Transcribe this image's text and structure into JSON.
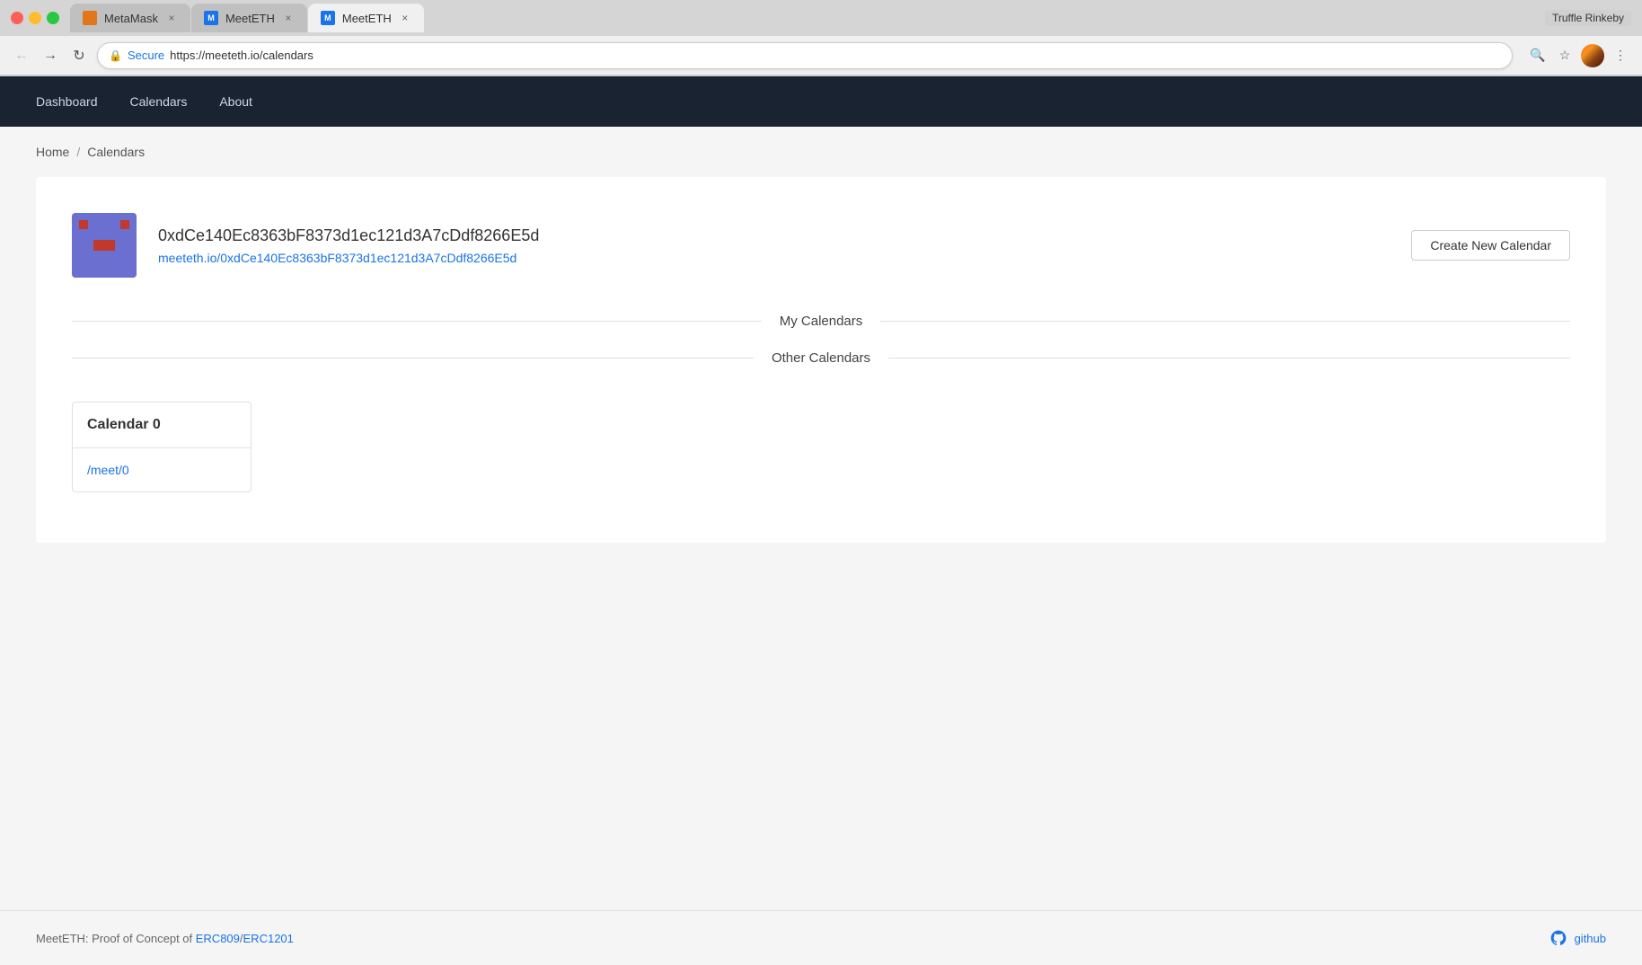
{
  "browser": {
    "tabs": [
      {
        "id": "metamask",
        "label": "MetaMask",
        "type": "metamask",
        "active": false
      },
      {
        "id": "meeteth1",
        "label": "MeetETH",
        "type": "meeteth",
        "active": false
      },
      {
        "id": "meeteth2",
        "label": "MeetETH",
        "type": "meeteth",
        "active": true
      }
    ],
    "right_label": "Truffle Rinkeby",
    "url": "https://meeteth.io/calendars",
    "secure_label": "Secure"
  },
  "nav": {
    "links": [
      {
        "id": "dashboard",
        "label": "Dashboard"
      },
      {
        "id": "calendars",
        "label": "Calendars"
      },
      {
        "id": "about",
        "label": "About"
      }
    ]
  },
  "breadcrumb": {
    "home": "Home",
    "separator": "/",
    "current": "Calendars"
  },
  "user": {
    "address": "0xdCe140Ec8363bF8373d1ec121d3A7cDdf8266E5d",
    "profile_url": "meeteth.io/0xdCe140Ec8363bF8373d1ec121d3A7cDdf8266E5d",
    "create_button": "Create New Calendar"
  },
  "sections": {
    "my_calendars": "My Calendars",
    "other_calendars": "Other Calendars"
  },
  "calendars": [
    {
      "name": "Calendar 0",
      "url": "/meet/0"
    }
  ],
  "footer": {
    "text_prefix": "MeetETH: Proof of Concept of ",
    "erc809": "ERC809",
    "slash": "/",
    "erc1201": "ERC1201",
    "github_label": "github"
  }
}
